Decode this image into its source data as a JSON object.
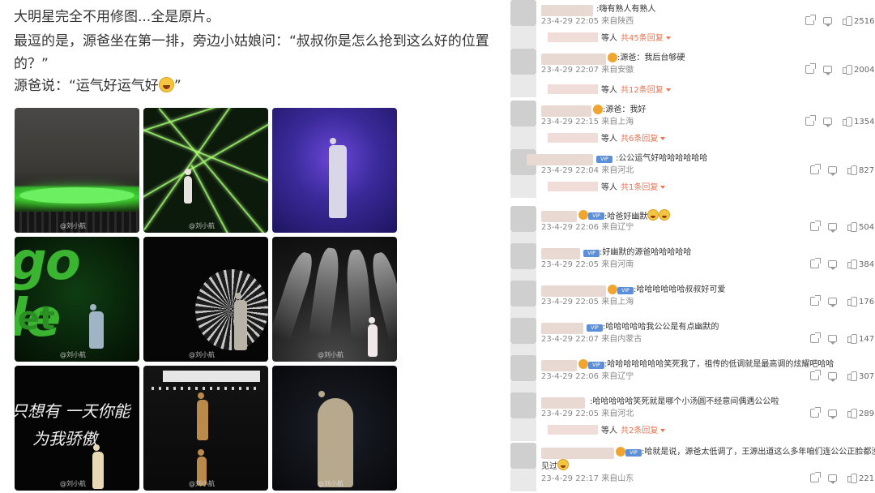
{
  "post": {
    "line1": "大明星完全不用修图...全是原片。",
    "line2": "最逗的是，源爸坐在第一排，旁边小姑娘问：“叔叔你是怎么抢到这么好的位置",
    "line3": "的？”",
    "line4": "源爸说：“运气好运气好",
    "line4_end": "”",
    "watermark": "@刘小航"
  },
  "photos": [
    {
      "wm": "@刘小航"
    },
    {
      "wm": "@刘小航"
    },
    {
      "wm": ""
    },
    {
      "wm": "@刘小航"
    },
    {
      "wm": "@刘小航"
    },
    {
      "wm": "@刘小航"
    },
    {
      "wm": "@刘小航"
    },
    {
      "wm": "@刘小航"
    },
    {
      "wm": "@刘小航"
    }
  ],
  "poem": {
    "line1": "只想有  一天你能",
    "line2": "为我骄傲"
  },
  "gotext": {
    "a": "go le",
    "b": "let"
  },
  "comments": [
    {
      "text": ":嗨有熟人有熟人",
      "meta": "23-4-29 22:05 来自陕西",
      "likes": "2516",
      "reply_who": "等人",
      "reply_cnt": "共45条回复"
    },
    {
      "text": ":源爸：我后台够硬",
      "meta": "23-4-29 22:07 来自安徽",
      "likes": "2004",
      "reply_who": "等人",
      "reply_cnt": "共12条回复"
    },
    {
      "text": ":源爸：我好",
      "meta": "23-4-29 22:15 来自上海",
      "likes": "1354",
      "reply_who": "等人",
      "reply_cnt": "共6条回复"
    },
    {
      "text": ":公公运气好哈哈哈哈哈哈",
      "meta": "23-4-29 22:04 来自河北",
      "likes": "827",
      "reply_who": "等人",
      "reply_cnt": "共1条回复"
    },
    {
      "text": ":哈爸好幽默",
      "meta": "23-4-29 22:06 来自辽宁",
      "likes": "504"
    },
    {
      "text": ":好幽默的源爸哈哈哈哈哈",
      "meta": "23-4-29 22:05 来自河南",
      "likes": "384"
    },
    {
      "text": ":哈哈哈哈哈哈叔叔好可爱",
      "meta": "23-4-29 22:05 来自上海",
      "likes": "176"
    },
    {
      "text": ":哈哈哈哈哈我公公是有点幽默的",
      "meta": "23-4-29 22:07 来自内蒙古",
      "likes": "147"
    },
    {
      "text": ":哈哈哈哈哈哈哈笑死我了，祖传的低调就是最高调的炫耀吧哈哈",
      "meta": "23-4-29 22:06 来自辽宁",
      "likes": "307"
    },
    {
      "text": ":哈哈哈哈哈笑死就是哪个小汤圆不经意间偶遇公公啦",
      "meta": "23-4-29 22:05 来自河北",
      "likes": "289",
      "reply_who": "等人",
      "reply_cnt": "共2条回复"
    },
    {
      "text": ":哈就是说，源爸太低调了，王源出道这么多年咱们连公公正脸都没",
      "text2": "见过",
      "meta": "23-4-29 22:17 来自山东",
      "likes": "221"
    }
  ]
}
